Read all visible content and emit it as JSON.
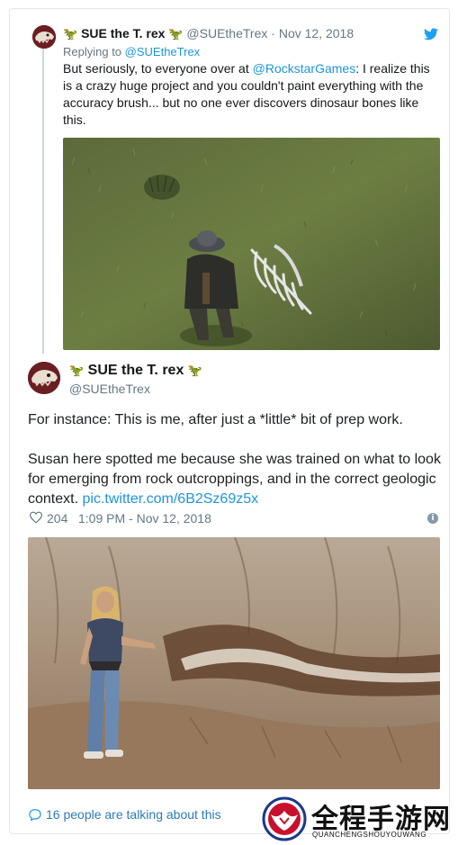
{
  "parent_tweet": {
    "display_name": "SUE the T. rex",
    "handle": "@SUEtheTrex",
    "separator": "·",
    "date": "Nov 12, 2018",
    "replying_prefix": "Replying to ",
    "replying_to": "@SUEtheTrex",
    "text_before_mention": "But seriously, to everyone over at ",
    "mention": "@RockstarGames",
    "text_after_mention": ": I realize this is a crazy huge project and you couldn't paint everything with the accuracy brush... but no one ever discovers dinosaur bones like this."
  },
  "main_tweet": {
    "display_name": "SUE the T. rex",
    "handle": "@SUEtheTrex",
    "paragraph_1": "For instance: This is me, after just a *little* bit of prep work.",
    "paragraph_2": "Susan here spotted me because she was trained on what to look for emerging from rock outcroppings, and in the correct geologic context. ",
    "link": "pic.twitter.com/6B2Sz69z5x",
    "likes": "204",
    "timestamp": "1:09 PM - Nov 12, 2018"
  },
  "footer": {
    "talking": "16 people are talking about this"
  },
  "watermark": {
    "title": "全程手游网",
    "subtitle": "QUANCHENGSHOUYOUWANG"
  },
  "icons": {
    "dino": "t-rex-emoji",
    "bird": "twitter-bird-icon",
    "heart": "heart-icon",
    "info": "info-icon",
    "bubble": "speech-bubble-icon"
  },
  "colors": {
    "link": "#1b95e0",
    "muted": "#657786",
    "border": "#e1e8ed",
    "twitter_blue": "#1da1f2",
    "watermark_red": "#c8102e"
  }
}
